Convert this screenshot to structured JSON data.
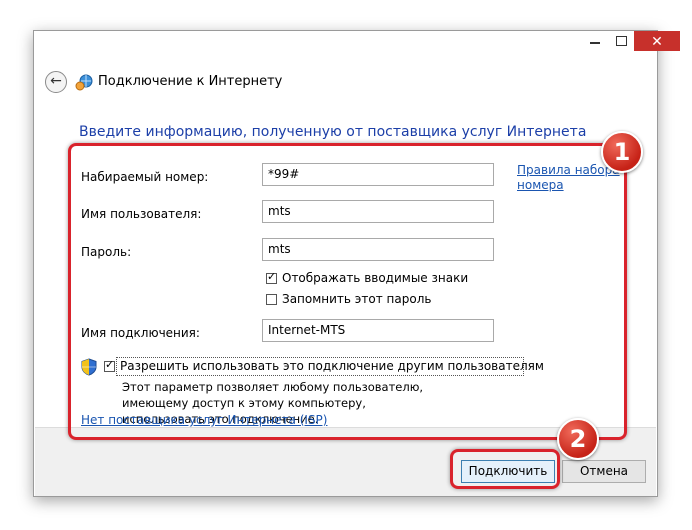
{
  "window": {
    "title": "Подключение к Интернету",
    "close_symbol": "✕"
  },
  "heading": "Введите информацию, полученную от поставщика услуг Интернета",
  "fields": {
    "dial_number": {
      "label": "Набираемый номер:",
      "value": "*99#"
    },
    "username": {
      "label": "Имя пользователя:",
      "value": "mts"
    },
    "password": {
      "label": "Пароль:",
      "value": "mts"
    },
    "connection_name": {
      "label": "Имя подключения:",
      "value": "Internet-MTS"
    }
  },
  "dialing_rules_link": {
    "line1": "Правила набора",
    "line2": "номера"
  },
  "show_chars": {
    "label": "Отображать вводимые знаки",
    "checked": true
  },
  "remember_password": {
    "label": "Запомнить этот пароль",
    "checked": false
  },
  "allow_others": {
    "label": "Разрешить использовать это подключение другим пользователям",
    "checked": true,
    "description": "Этот параметр позволяет любому пользователю, имеющему доступ к этому компьютеру, использовать это подключение."
  },
  "no_isp_link": "Нет поставщика услуг Интернета (ISP)",
  "buttons": {
    "connect": "Подключить",
    "cancel": "Отмена"
  },
  "annotations": {
    "badge1": "1",
    "badge2": "2",
    "frame_color": "#d9232c"
  },
  "colors": {
    "heading": "#1c3fa8",
    "link": "#1a55b0",
    "close_button": "#c7302b"
  }
}
